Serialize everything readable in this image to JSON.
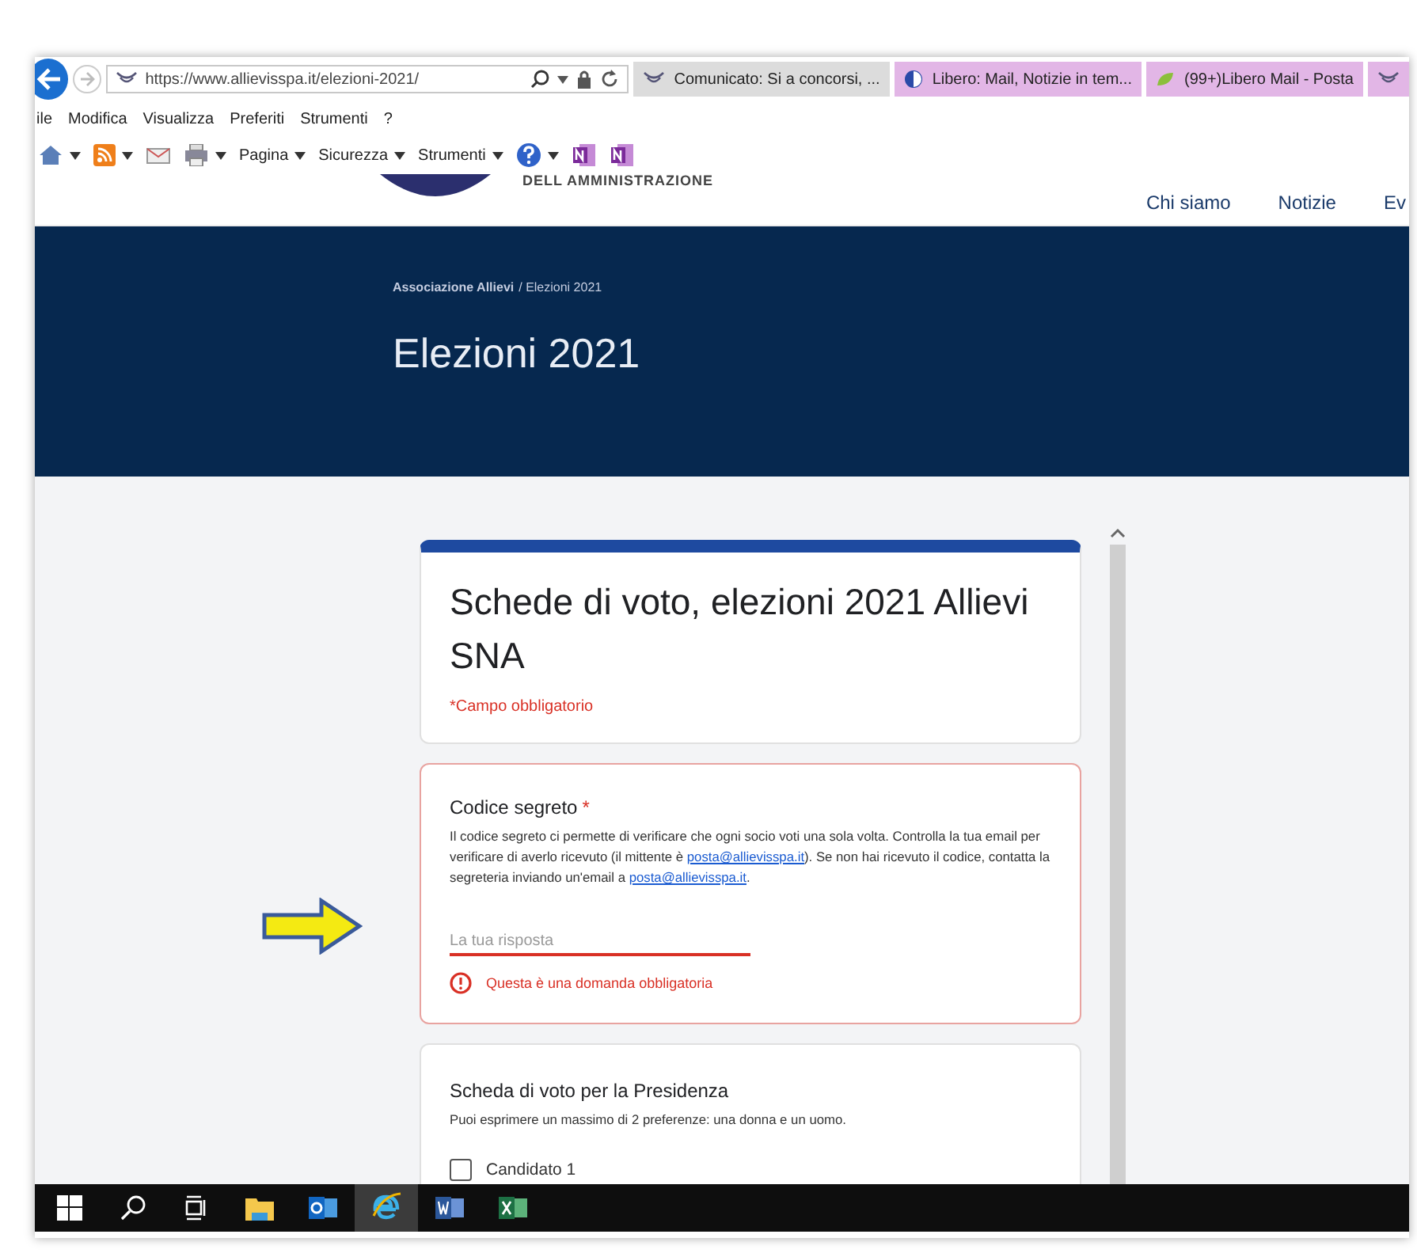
{
  "browser": {
    "url": "https://www.allievisspa.it/elezioni-2021/",
    "tabs": [
      {
        "label": "Comunicato: Si a concorsi, ...",
        "color": "#dcdcdc",
        "kind": "news"
      },
      {
        "label": "Libero: Mail, Notizie in tem...",
        "color": "#e2b6e6",
        "kind": "libero"
      },
      {
        "label": "(99+)Libero Mail - Posta",
        "color": "#e2b6e6",
        "kind": "mail"
      },
      {
        "color": "#e2b6e6",
        "kind": "news"
      }
    ],
    "menu": [
      "ile",
      "Modifica",
      "Visualizza",
      "Preferiti",
      "Strumenti",
      "?"
    ],
    "toolbar": [
      {
        "kind": "home",
        "caret": true
      },
      {
        "kind": "rss",
        "caret": true
      },
      {
        "kind": "mail",
        "caret": false
      },
      {
        "kind": "print",
        "caret": true
      },
      {
        "kind": "menu",
        "label": "Pagina",
        "caret": true
      },
      {
        "kind": "menu",
        "label": "Sicurezza",
        "caret": true
      },
      {
        "kind": "menu",
        "label": "Strumenti",
        "caret": true
      },
      {
        "kind": "help",
        "caret": true
      },
      {
        "kind": "onenote",
        "caret": false
      },
      {
        "kind": "onenote",
        "caret": false
      }
    ]
  },
  "site": {
    "logo_text": "DELL AMMINISTRAZIONE",
    "nav": [
      "Chi siamo",
      "Notizie",
      "Ev"
    ],
    "breadcrumb": [
      "Associazione Allievi",
      "/ Elezioni 2021"
    ],
    "title": "Elezioni 2021"
  },
  "form": {
    "title": "Schede di voto, elezioni 2021 Allievi SNA",
    "required_note": "*Campo obbligatorio",
    "question": {
      "label": "Codice segreto",
      "required_mark": "*",
      "description": [
        {
          "kind": "text",
          "text": "Il codice segreto ci permette di verificare che ogni socio voti una sola volta. Controlla la tua email per verificare di averlo ricevuto (il mittente è "
        },
        {
          "kind": "link",
          "text": "posta@allievisspa.it"
        },
        {
          "kind": "text",
          "text": "). Se non hai ricevuto il codice, contatta la segreteria inviando un'email a "
        },
        {
          "kind": "link",
          "text": "posta@allievisspa.it"
        },
        {
          "kind": "text",
          "text": "."
        }
      ],
      "placeholder": "La tua risposta",
      "error": true,
      "error_text": "Questa è una domanda obbligatoria"
    },
    "section": {
      "title": "Scheda di voto per la Presidenza",
      "note": "Puoi esprimere un massimo di 2 preferenze: una donna e un uomo.",
      "options": [
        {
          "label": "Candidato 1",
          "checked": false
        }
      ]
    }
  },
  "taskbar": [
    {
      "kind": "start",
      "selected": false
    },
    {
      "kind": "search",
      "selected": false
    },
    {
      "kind": "taskview",
      "selected": false
    },
    {
      "kind": "folder",
      "selected": false
    },
    {
      "kind": "outlook",
      "selected": false
    },
    {
      "kind": "ie",
      "selected": true
    },
    {
      "kind": "word",
      "selected": false
    },
    {
      "kind": "excel",
      "selected": false
    }
  ]
}
